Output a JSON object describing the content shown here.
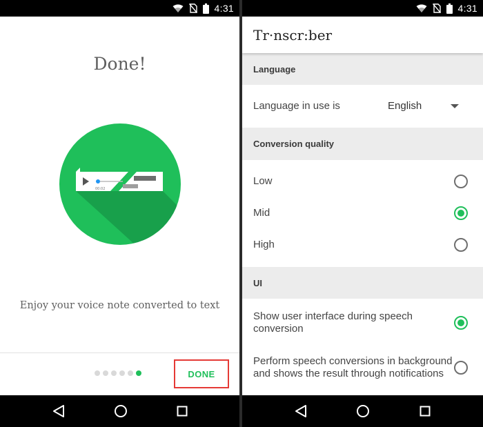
{
  "status_bar": {
    "time": "4:31"
  },
  "onboarding": {
    "title": "Done!",
    "caption": "Enjoy your voice note converted to text",
    "illustration": {
      "timestamp": "00:02",
      "color": "#1fbf5a"
    },
    "page_dots": [
      false,
      false,
      false,
      false,
      false,
      true
    ],
    "done_label": "DONE"
  },
  "settings": {
    "app_title": "Tr·nscr:ber",
    "sections": {
      "language": "Language",
      "quality": "Conversion quality",
      "ui": "UI"
    },
    "language_row": {
      "label": "Language in use is",
      "value": "English"
    },
    "quality_options": [
      {
        "label": "Low",
        "checked": false
      },
      {
        "label": "Mid",
        "checked": true
      },
      {
        "label": "High",
        "checked": false
      }
    ],
    "ui_options": [
      {
        "label": "Show user interface during speech conversion",
        "checked": true
      },
      {
        "label": "Perform speech conversions in background and shows the result through notifications",
        "checked": false
      }
    ]
  },
  "colors": {
    "accent": "#1fbf5a",
    "highlight": "#e53935"
  }
}
